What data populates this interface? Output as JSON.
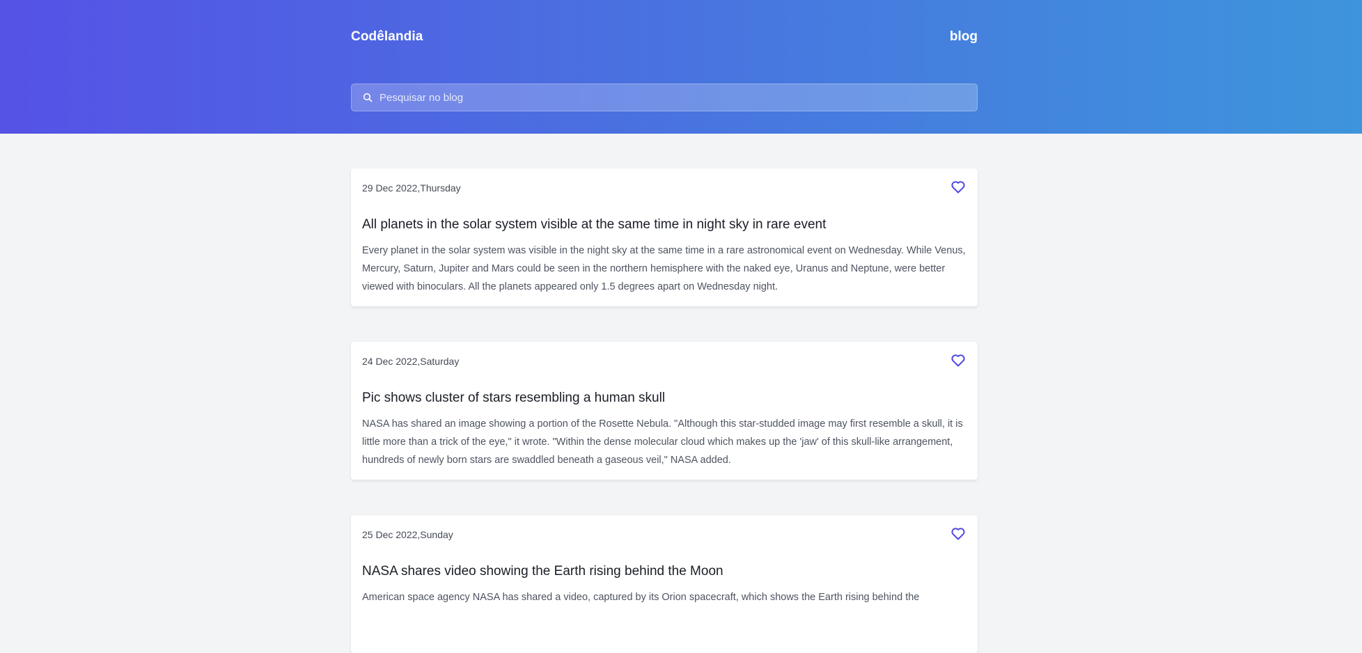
{
  "header": {
    "brand": "Codêlandia",
    "nav_link": "blog",
    "search_placeholder": "Pesquisar no blog"
  },
  "colors": {
    "gradient_start": "#5552e6",
    "gradient_end": "#3d95dc",
    "accent": "#4f46e5",
    "page_background": "#f3f4f6"
  },
  "posts": [
    {
      "date": "29 Dec 2022,Thursday",
      "title": "All planets in the solar system visible at the same time in night sky in rare event",
      "excerpt": "Every planet in the solar system was visible in the night sky at the same time in a rare astronomical event on Wednesday. While Venus, Mercury, Saturn, Jupiter and Mars could be seen in the northern hemisphere with the naked eye, Uranus and Neptune, were better viewed with binoculars. All the planets appeared only 1.5 degrees apart on Wednesday night.",
      "icon": "heart-icon"
    },
    {
      "date": "24 Dec 2022,Saturday",
      "title": "Pic shows cluster of stars resembling a human skull",
      "excerpt": "NASA has shared an image showing a portion of the Rosette Nebula. \"Although this star-studded image may first resemble a skull, it is little more than a trick of the eye,\" it wrote. \"Within the dense molecular cloud which makes up the 'jaw' of this skull-like arrangement, hundreds of newly born stars are swaddled beneath a gaseous veil,\" NASA added.",
      "icon": "heart-icon"
    },
    {
      "date": "25 Dec 2022,Sunday",
      "title": "NASA shares video showing the Earth rising behind the Moon",
      "excerpt": "American space agency NASA has shared a video, captured by its Orion spacecraft, which shows the Earth rising behind the",
      "icon": "heart-icon"
    }
  ]
}
